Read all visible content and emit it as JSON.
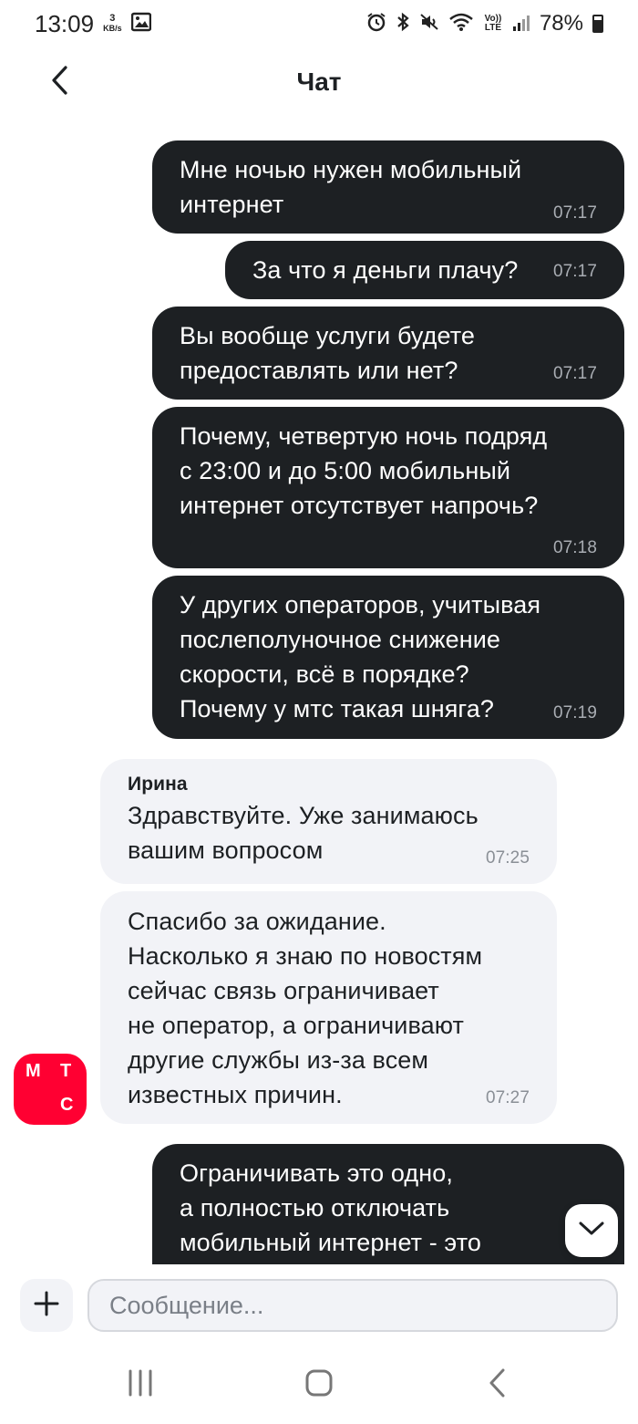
{
  "status_bar": {
    "time": "13:09",
    "net_speed_value": "3",
    "net_speed_unit": "KB/s",
    "lte_label": "Vo)) LTE",
    "battery": "78%"
  },
  "header": {
    "title": "Чат"
  },
  "messages": [
    {
      "text": "Мне ночью нужен мобильный\nинтернет",
      "time": "07:17"
    },
    {
      "text": "За что я деньги плачу?",
      "time": "07:17"
    },
    {
      "text": "Вы вообще услуги будете\nпредоставлять или нет?",
      "time": "07:17"
    },
    {
      "text": "Почему, четвертую ночь подряд\nс 23:00 и до 5:00 мобильный\nинтернет отсутствует напрочь?",
      "time": "07:18"
    },
    {
      "text": "У других операторов, учитывая\nпослеполуночное снижение\nскорости, всё в порядке?\nПочему у мтс такая шняга?",
      "time": "07:19"
    },
    {
      "sender": "Ирина",
      "text": "Здравствуйте. Уже занимаюсь\nвашим вопросом",
      "time": "07:25"
    },
    {
      "text": "Спасибо за ожидание.\nНасколько я знаю по новостям\nсейчас связь ограничивает\nне оператор, а ограничивают\nдругие службы из-за всем\nизвестных причин.",
      "time": "07:27"
    },
    {
      "text": "Ограничивать это одно,\nа полностью отключать\nмобильный интернет - это"
    }
  ],
  "avatar": {
    "letters": [
      "М",
      "Т",
      "С"
    ],
    "color": "#ff0032"
  },
  "input": {
    "placeholder": "Сообщение..."
  },
  "icons": {
    "back": "chevron-left-icon",
    "add": "plus-icon",
    "scroll_down": "chevron-down-icon",
    "nav_recents": "recents-icon",
    "nav_home": "home-icon",
    "nav_back": "back-icon"
  },
  "colors": {
    "outgoing_bubble": "#1d2023",
    "incoming_bubble": "#f2f3f7",
    "accent": "#ff0032"
  }
}
